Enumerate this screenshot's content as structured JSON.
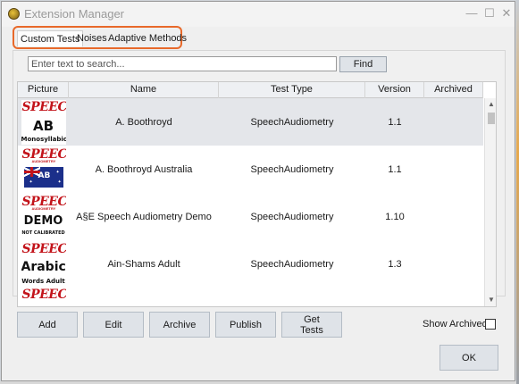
{
  "window": {
    "title": "Extension Manager",
    "minimize_glyph": "—",
    "maximize_glyph": "☐",
    "close_glyph": "✕"
  },
  "tabs": [
    {
      "label": "Custom Tests",
      "active": true
    },
    {
      "label": "Noises",
      "active": false
    },
    {
      "label": "Adaptive Methods",
      "active": false
    }
  ],
  "search": {
    "placeholder": "Enter text to search...",
    "value": "",
    "find_label": "Find"
  },
  "table": {
    "columns": [
      "Picture",
      "Name",
      "Test Type",
      "Version",
      "Archived"
    ],
    "rows": [
      {
        "picture": {
          "brand": "SPEECH",
          "main": "AB",
          "caption": "Monosyllabic"
        },
        "name": "A. Boothroyd",
        "test_type": "SpeechAudiometry",
        "version": "1.1",
        "archived": "",
        "selected": true
      },
      {
        "picture": {
          "brand": "SPEECH",
          "sub": "AUDIOMETRY",
          "main": "AB",
          "caption": ""
        },
        "name": "A. Boothroyd Australia",
        "test_type": "SpeechAudiometry",
        "version": "1.1",
        "archived": "",
        "selected": false
      },
      {
        "picture": {
          "brand": "SPEECH",
          "sub": "AUDIOMETRY",
          "main": "DEMO",
          "caption": "NOT CALIBRATED"
        },
        "name": "A§E Speech Audiometry Demo",
        "test_type": "SpeechAudiometry",
        "version": "1.10",
        "archived": "",
        "selected": false
      },
      {
        "picture": {
          "brand": "SPEECH",
          "main": "Arabic",
          "caption": "Words Adult"
        },
        "name": "Ain-Shams Adult",
        "test_type": "SpeechAudiometry",
        "version": "1.3",
        "archived": "",
        "selected": false
      },
      {
        "picture": {
          "brand": "SPEECH",
          "main": "",
          "caption": ""
        },
        "name": "",
        "test_type": "",
        "version": "",
        "archived": "",
        "selected": false
      }
    ]
  },
  "buttons": {
    "add": "Add",
    "edit": "Edit",
    "archive": "Archive",
    "publish": "Publish",
    "get_tests": "Get Tests",
    "ok": "OK"
  },
  "show_archived": {
    "label": "Show Archived",
    "checked": false
  },
  "colors": {
    "tab_highlight": "#e8692a",
    "speech_red": "#c3141b",
    "button_bg": "#dfe3e8",
    "selected_row": "#e4e6ea"
  }
}
